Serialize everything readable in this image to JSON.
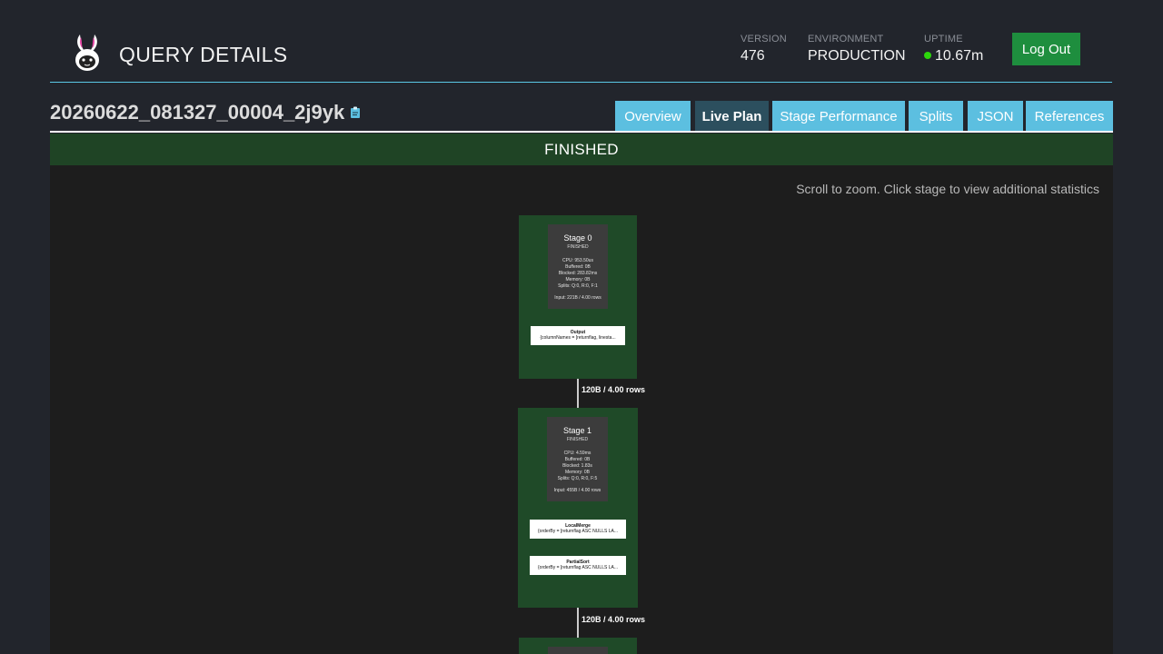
{
  "header": {
    "title": "QUERY DETAILS",
    "version": {
      "label": "VERSION",
      "value": "476"
    },
    "environment": {
      "label": "ENVIRONMENT",
      "value": "PRODUCTION"
    },
    "uptime": {
      "label": "UPTIME",
      "value": "10.67m",
      "status_color": "#2cd60b"
    },
    "logout_label": "Log Out"
  },
  "query": {
    "id": "20260622_081327_00004_2j9yk",
    "copy_icon": "clipboard-icon"
  },
  "tabs": [
    {
      "label": "Overview",
      "active": false
    },
    {
      "label": "Live Plan",
      "active": true
    },
    {
      "label": "Stage Performance",
      "active": false
    },
    {
      "label": "Splits",
      "active": false
    },
    {
      "label": "JSON",
      "active": false
    },
    {
      "label": "References",
      "active": false
    }
  ],
  "status": "FINISHED",
  "plan": {
    "hint": "Scroll to zoom. Click stage to view additional statistics",
    "stages": [
      {
        "title": "Stage 0",
        "state": "FINISHED",
        "stats": [
          "CPU: 953.50us",
          "Buffered: 0B",
          "Blocked: 283.82ms",
          "Memory: 0B",
          "Splits: Q:0, R:0, F:1"
        ],
        "input": "Input: 221B / 4.00 rows",
        "operators": [
          {
            "title": "Output",
            "detail": "{columnNames = [returnflag, linesta..."
          }
        ]
      },
      {
        "title": "Stage 1",
        "state": "FINISHED",
        "stats": [
          "CPU: 4.59ms",
          "Buffered: 0B",
          "Blocked: 1.83s",
          "Memory: 0B",
          "Splits: Q:0, R:0, F:5"
        ],
        "input": "Input: 455B / 4.00 rows",
        "operators": [
          {
            "title": "LocalMerge",
            "detail": "{orderBy = [returnflag ASC NULLS LA..."
          },
          {
            "title": "PartialSort",
            "detail": "{orderBy = [returnflag ASC NULLS LA..."
          }
        ]
      }
    ],
    "edges": [
      {
        "label": "120B / 4.00 rows"
      },
      {
        "label": "120B / 4.00 rows"
      }
    ]
  }
}
